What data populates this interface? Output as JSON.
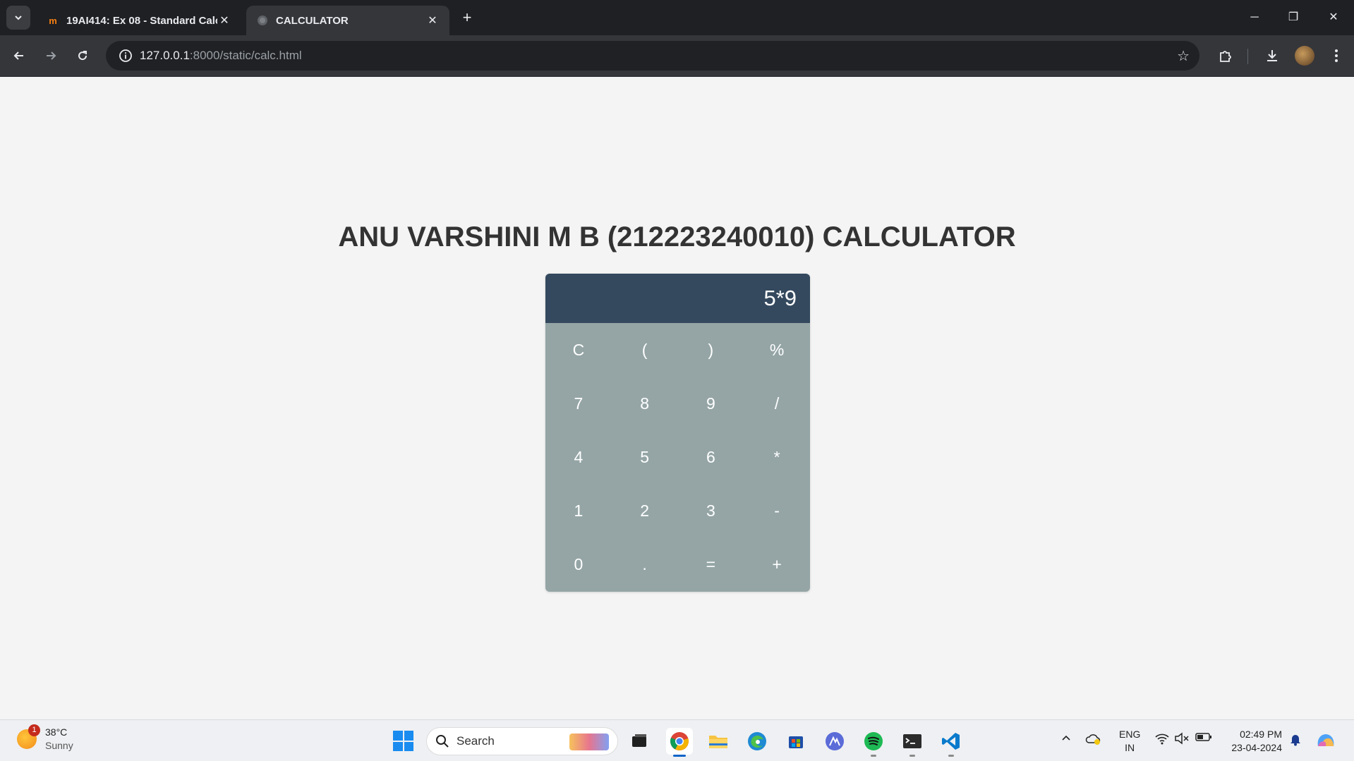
{
  "browser": {
    "tabs": [
      {
        "title": "19AI414: Ex 08 - Standard Calcu",
        "favicon": "moodle-icon",
        "active": false
      },
      {
        "title": "CALCULATOR",
        "favicon": "globe-icon",
        "active": true
      }
    ],
    "url": {
      "host": "127.0.0.1",
      "rest": ":8000/static/calc.html"
    }
  },
  "page": {
    "heading": "ANU VARSHINI M B (212223240010) CALCULATOR",
    "display": "5*9",
    "keys": [
      "C",
      "(",
      ")",
      "%",
      "7",
      "8",
      "9",
      "/",
      "4",
      "5",
      "6",
      "*",
      "1",
      "2",
      "3",
      "-",
      "0",
      ".",
      "=",
      "+"
    ]
  },
  "colors": {
    "display_bg": "#34495e",
    "keypad_bg": "#95a5a6",
    "page_bg": "#f4f4f4",
    "heading": "#333333"
  },
  "taskbar": {
    "weather": {
      "temp": "38°C",
      "condition": "Sunny",
      "badge": "1"
    },
    "search_label": "Search",
    "apps": [
      "task-view-icon",
      "chrome-icon",
      "file-explorer-icon",
      "edge-icon",
      "store-icon",
      "app-icon",
      "spotify-icon",
      "terminal-icon",
      "vscode-icon"
    ],
    "lang": {
      "line1": "ENG",
      "line2": "IN"
    },
    "time": "02:49 PM",
    "date": "23-04-2024"
  }
}
